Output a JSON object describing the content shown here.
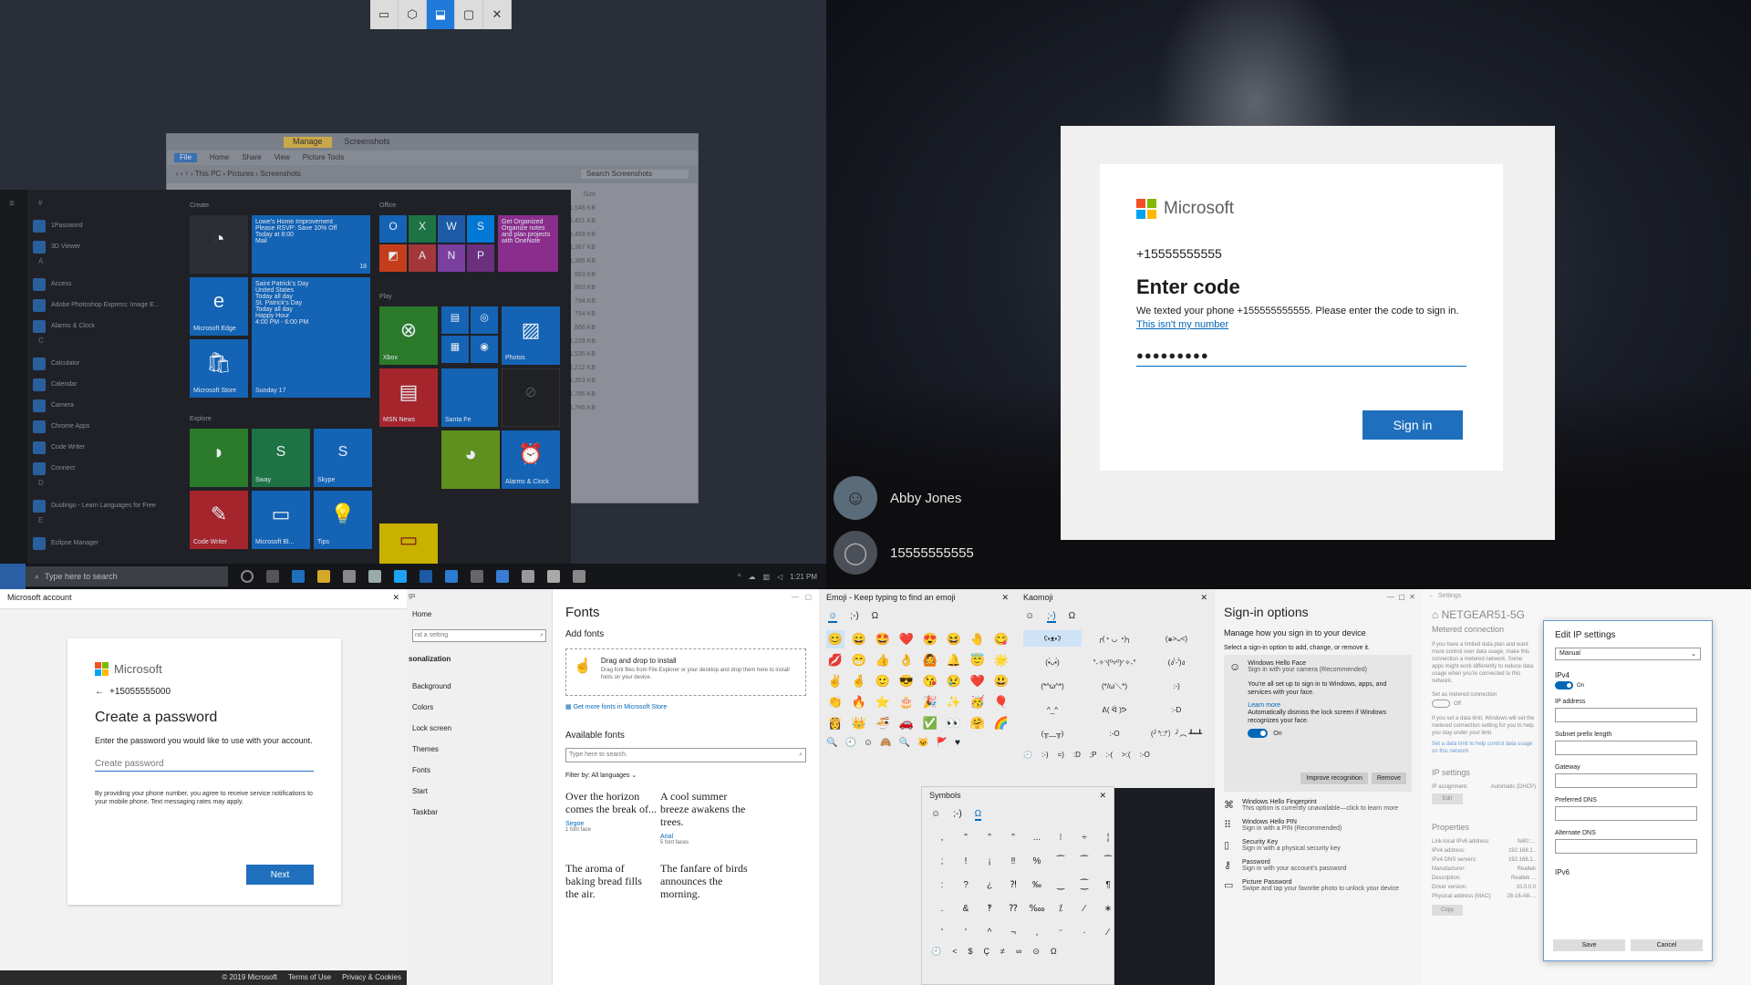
{
  "q1": {
    "snip_tools": [
      "▭",
      "⬡",
      "⬓",
      "▢",
      "✕"
    ],
    "explorer": {
      "title_tabs": [
        "Manage",
        "Screenshots"
      ],
      "ribbon": [
        "File",
        "Home",
        "Share",
        "View",
        "Picture Tools"
      ],
      "path": "‹ › ↑ › This PC › Pictures › Screenshots",
      "search": "Search Screenshots",
      "size_header": "Size",
      "sizes": [
        "1,546 KB",
        "1,451 KB",
        "1,489 KB",
        "1,387 KB",
        "1,385 KB",
        "883 KB",
        "883 KB",
        "794 KB",
        "794 KB",
        "866 KB",
        "1,229 KB",
        "1,535 KB",
        "1,212 KB",
        "1,353 KB",
        "1,786 KB",
        "1,786 KB"
      ]
    },
    "start_menu": {
      "apps": [
        {
          "letter": "#"
        },
        {
          "label": "1Password"
        },
        {
          "label": "3D Viewer"
        },
        {
          "letter": "A"
        },
        {
          "label": "Access"
        },
        {
          "label": "Adobe Photoshop Express: Image E..."
        },
        {
          "label": "Alarms & Clock"
        },
        {
          "letter": "C"
        },
        {
          "label": "Calculator"
        },
        {
          "label": "Calendar"
        },
        {
          "label": "Camera"
        },
        {
          "label": "Chrome Apps"
        },
        {
          "label": "Code Writer"
        },
        {
          "label": "Connect"
        },
        {
          "letter": "D"
        },
        {
          "label": "Duolingo - Learn Languages for Free"
        },
        {
          "letter": "E"
        },
        {
          "label": "Eclipse Manager"
        }
      ],
      "groups": [
        "Create",
        "Office",
        "Play",
        "Explore"
      ],
      "tiles": {
        "mail_text": "Lowe's Home Improvement\nPlease RSVP: Save 10% Off\nToday at 8:00\nMail",
        "mail_label": "Mail",
        "mail_count": "18",
        "edge": "Microsoft Edge",
        "calendar_text": "Saint Patrick's Day\nUnited States\nToday all day\nSt. Patrick's Day\nToday all day\nHappy Hour\n4:00 PM - 6:00 PM",
        "calendar_day": "Sunday 17",
        "store": "Microsoft Store",
        "get_organized": "Get Organized\nOrganize notes and plan projects with OneNote",
        "xbox": "Xbox",
        "photos": "Photos",
        "msn_news": "MSN News",
        "weather": "Santa Fe",
        "sway": "Sway",
        "skype": "Skype",
        "alarms": "Alarms & Clock",
        "code_writer": "Code Writer",
        "ms_whiteboard": "Microsoft Bl...",
        "tips": "Tips"
      }
    },
    "taskbar": {
      "search": "Type here to search",
      "time": "1:21 PM"
    }
  },
  "q2": {
    "brand": "Microsoft",
    "phone": "+15555555555",
    "heading": "Enter code",
    "message": "We texted your phone +155555555555. Please enter the code to sign in.",
    "link": "This isn't my number",
    "code_value": "●●●●●●●●●",
    "sign_in": "Sign in",
    "users": [
      "Abby Jones",
      "15555555555"
    ]
  },
  "p1": {
    "window_title": "Microsoft account",
    "brand": "Microsoft",
    "phone": "+15055555000",
    "heading": "Create a password",
    "instruction": "Enter the password you would like to use with your account.",
    "placeholder": "Create password",
    "disclaimer": "By providing your phone number, you agree to receive service notifications to your mobile phone. Text messaging rates may apply.",
    "next": "Next",
    "footer": [
      "© 2019 Microsoft",
      "Terms of Use",
      "Privacy & Cookies"
    ]
  },
  "p2": {
    "title": "gs",
    "home": "Home",
    "search": "nd a setting",
    "section": "sonalization",
    "items": [
      "Background",
      "Colors",
      "Lock screen",
      "Themes",
      "Fonts",
      "Start",
      "Taskbar"
    ]
  },
  "p3": {
    "heading": "Fonts",
    "add_fonts": "Add fonts",
    "drop_title": "Drag and drop to install",
    "drop_desc": "Drag font files from File Explorer or your desktop and drop them here to install fonts on your device.",
    "store_link": "Get more fonts in Microsoft Store",
    "available": "Available fonts",
    "search": "Type here to search.",
    "filter_label": "Filter by:",
    "filter_value": "All languages",
    "samples": [
      {
        "text": "Over the horizon comes the break of...",
        "name": "Segoe",
        "faces": "1 font face"
      },
      {
        "text": "A cool summer breeze awakens the trees.",
        "name": "Arial",
        "faces": "5 font faces"
      },
      {
        "text": "The aroma of baking bread fills the air.",
        "name": "",
        "faces": ""
      },
      {
        "text": "The fanfare of birds announces the morning.",
        "name": "",
        "faces": ""
      }
    ]
  },
  "p4": {
    "title": "Emoji - Keep typing to find an emoji",
    "tabs": [
      "☺",
      ";-)",
      "Ω"
    ],
    "emoji": [
      "😊",
      "😄",
      "🤩",
      "❤️",
      "😍",
      "😆",
      "🤚",
      "😋",
      "💋",
      "😁",
      "👍",
      "👌",
      "🙆",
      "🔔",
      "😇",
      "🌟",
      "✌️",
      "🤞",
      "🙂",
      "😎",
      "😘",
      "😢",
      "❤️",
      "😃",
      "👏",
      "🔥",
      "⭐",
      "🎂",
      "🎉",
      "✨",
      "🥳",
      "🎈",
      "👸",
      "👑",
      "🍜",
      "🚗",
      "✅",
      "👀",
      "🤗",
      "🌈"
    ],
    "categories": [
      "🔍",
      "🕘",
      "☺",
      "🙈",
      "🔍",
      "🐱",
      "🚩",
      "♥"
    ]
  },
  "p5": {
    "title": "Kaomoji",
    "tabs": [
      "☺",
      ";-)",
      "Ω"
    ],
    "kaomoji": [
      "ʕ•ᴥ•ʔ",
      "╭(◔ ◡ ◔)╮",
      "(๑˃ᴗ˂)",
      "(•̀ᴗ•́)",
      "°˖✧◝(⁰▿⁰)◜✧˖°",
      "(ง'̀-'́)ง",
      "(*^ω^*)",
      "(*/ω＼*)",
      ":-)",
      "^_^",
      "ᕕ( ᐛ )ᕗ",
      ":-D",
      "(╥﹏╥)",
      ":-O",
      "(╯°□°）╯︵ ┻━┻"
    ],
    "bottom": [
      "🕘",
      ":-)",
      "=)",
      ":D",
      ";P",
      ":-(",
      ">:(",
      ":-O"
    ]
  },
  "symbols": {
    "title": "Symbols",
    "tabs": [
      "☺",
      ";-)",
      "Ω"
    ],
    "chars": [
      ",",
      "\"",
      "\"",
      "\"",
      "...",
      "⁝",
      "÷",
      "¦",
      ";",
      "!",
      "¡",
      "‼",
      "%",
      "⁀",
      "⁀",
      "⁀",
      ":",
      "?",
      "¿",
      "⁈",
      "‰",
      "‿",
      "⁐",
      "¶",
      ".",
      "&",
      "‽",
      "⁇",
      "‱",
      "⁒",
      "⁄",
      "∗",
      "'",
      "'",
      "^",
      "¬",
      "‚",
      "⁻",
      "·",
      "∕"
    ],
    "bottom": [
      "🕘",
      "<",
      "$",
      "Ç",
      "≠",
      "∞",
      "⊙",
      "Ω"
    ]
  },
  "p6": {
    "heading": "Sign-in options",
    "subheading": "Manage how you sign in to your device",
    "instruction": "Select a sign-in option to add, change, or remove it.",
    "hello_face": {
      "title": "Windows Hello Face",
      "sub": "Sign in with your camera (Recommended)",
      "desc": "You're all set up to sign in to Windows, apps, and services with your face.",
      "learn": "Learn more",
      "auto": "Automatically dismiss the lock screen if Windows recognizes your face.",
      "toggle": "On",
      "improve": "Improve recognition",
      "remove": "Remove"
    },
    "options": [
      {
        "icon": "fingerprint-icon",
        "glyph": "⌘",
        "title": "Windows Hello Fingerprint",
        "desc": "This option is currently unavailable—click to learn more"
      },
      {
        "icon": "pin-icon",
        "glyph": "⠿",
        "title": "Windows Hello PIN",
        "desc": "Sign in with a PIN (Recommended)"
      },
      {
        "icon": "key-icon",
        "glyph": "▯",
        "title": "Security Key",
        "desc": "Sign in with a physical security key"
      },
      {
        "icon": "password-icon",
        "glyph": "⚷",
        "title": "Password",
        "desc": "Sign in with your account's password"
      },
      {
        "icon": "picture-icon",
        "glyph": "▭",
        "title": "Picture Password",
        "desc": "Swipe and tap your favorite photo to unlock your device"
      }
    ]
  },
  "p7": {
    "window": "Settings",
    "network": "NETGEAR51-5G",
    "metered": "Metered connection",
    "metered_desc": "If you have a limited data plan and want more control over data usage, make this connection a metered network. Some apps might work differently to reduce data usage when you're connected to this network.",
    "set_metered": "Set as metered connection",
    "off": "Off",
    "limit_desc": "If you set a data limit, Windows will set the metered connection setting for you to help you stay under your limit.",
    "limit_link": "Set a data limit to help control data usage on this network",
    "ip_settings": "IP settings",
    "ip_assignment": "IP assignment:",
    "ip_assignment_val": "Automatic (DHCP)",
    "edit": "Edit",
    "properties": "Properties",
    "props": [
      [
        "Link-local IPv6 address:",
        "fe80::..."
      ],
      [
        "IPv4 address:",
        "192.168.1.."
      ],
      [
        "IPv4 DNS servers:",
        "192.168.1.."
      ],
      [
        "Manufacturer:",
        "Realtek"
      ],
      [
        "Description:",
        "Realtek ..."
      ],
      [
        "Driver version:",
        "10.0.0.0"
      ],
      [
        "Physical address (MAC):",
        "28-16-A8-..."
      ]
    ],
    "copy": "Copy",
    "dialog": {
      "title": "Edit IP settings",
      "mode": "Manual",
      "ipv4": "IPv4",
      "on": "On",
      "fields": [
        "IP address",
        "Subnet prefix length",
        "Gateway",
        "Preferred DNS",
        "Alternate DNS"
      ],
      "ipv6": "IPv6",
      "save": "Save",
      "cancel": "Cancel"
    }
  }
}
